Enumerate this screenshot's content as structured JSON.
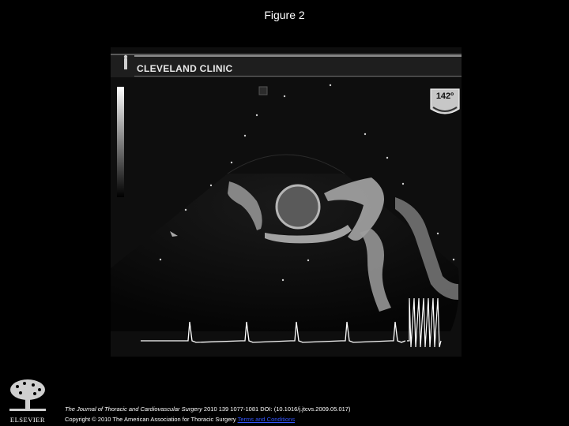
{
  "figure": {
    "title": "Figure 2"
  },
  "echo": {
    "brand": "CLEVELAND CLINIC",
    "angle": "142º"
  },
  "footer": {
    "journal": "The Journal of Thoracic and Cardiovascular Surgery",
    "citation": " 2010 139 1077-1081 DOI: (10.1016/j.jtcvs.2009.05.017)",
    "copyright": "Copyright © 2010 The American Association for Thoracic Surgery ",
    "link": "Terms and Conditions"
  },
  "publisher": {
    "name": "ELSEVIER"
  }
}
